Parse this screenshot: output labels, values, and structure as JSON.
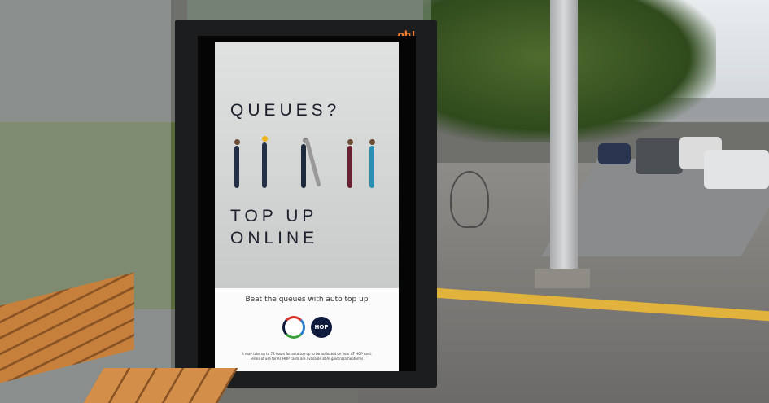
{
  "scene": "bus shelter advertisement",
  "operator_logo": ".oh!",
  "poster": {
    "headline_1": "QUEUES?",
    "headline_2": "TOP UP",
    "headline_3": "ONLINE",
    "tagline": "Beat the queues with auto top up",
    "at_logo": "AT",
    "hop_logo": "HOP",
    "fine_print_1": "It may take up to 72 hours for auto top-up to be activated on your AT HOP card.",
    "fine_print_2": "Terms of use for AT HOP cards are available at AT.govt.nz/athopterms"
  },
  "colors": {
    "brand_navy": "#0f1b3d",
    "oh_orange": "#f47c2a",
    "kerb_yellow": "#e1b23c"
  }
}
